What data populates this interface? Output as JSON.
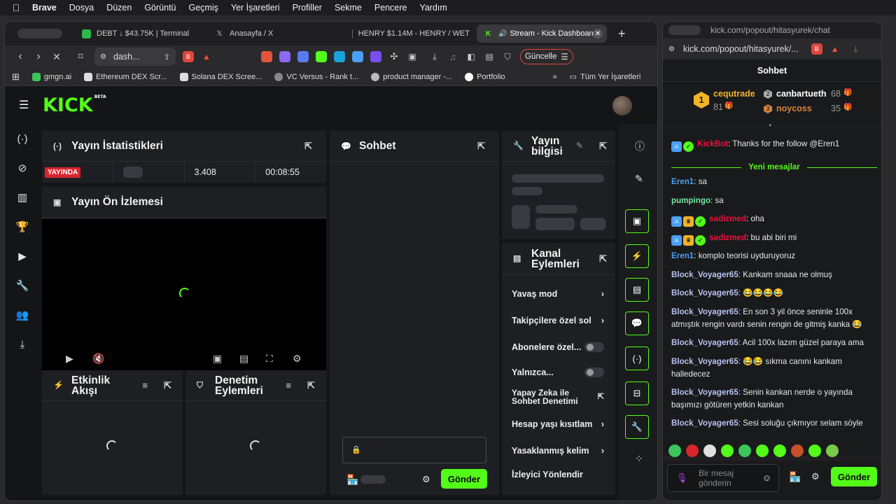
{
  "menubar": {
    "apple": "",
    "items": [
      "Brave",
      "Dosya",
      "Düzen",
      "Görüntü",
      "Geçmiş",
      "Yer İşaretleri",
      "Profiller",
      "Sekme",
      "Pencere",
      "Yardım"
    ]
  },
  "tabs": [
    {
      "title": "DEBT ↓ $43.75K | Terminal",
      "color": "#2fb84a"
    },
    {
      "title": "Anasayfa / X",
      "color": "#000000"
    },
    {
      "title": "HENRY $1.14M - HENRY / WET",
      "color": "#777777"
    },
    {
      "title": "Stream - Kick Dashboard",
      "color": "#53fc18"
    }
  ],
  "newtab": "+",
  "address": {
    "url": "dash...",
    "update_label": "Güncelle"
  },
  "bookmarks": [
    {
      "label": "gmgn.ai",
      "color": "#3cc55b"
    },
    {
      "label": "Ethereum DEX Scr...",
      "color": "#dddddd"
    },
    {
      "label": "Solana DEX Scree...",
      "color": "#dddddd"
    },
    {
      "label": "VC Versus - Rank t...",
      "color": "#aaaaaa"
    },
    {
      "label": "product manager -...",
      "color": "#cccccc"
    },
    {
      "label": "Portfolio",
      "color": "#ffffff"
    }
  ],
  "bookmarks_more": "»",
  "bookmarks_all": "Tüm Yer İşaretleri",
  "kick": {
    "logo": "KICK",
    "logo_beta": "BETA",
    "stats": {
      "title": "Yayın İstatistikleri",
      "live": "YAYINDA",
      "viewers": "3.408",
      "duration": "00:08:55"
    },
    "preview": {
      "title": "Yayın Ön İzlemesi"
    },
    "chat": {
      "title": "Sohbet",
      "send": "Gönder"
    },
    "stream_info": {
      "title_line1": "Yayın",
      "title_line2": "bilgisi"
    },
    "channel_actions": {
      "title_line1": "Kanal",
      "title_line2": "Eylemleri",
      "items": [
        {
          "label": "Yavaş mod",
          "kind": "chevron"
        },
        {
          "label": "Takipçilere özel sol",
          "kind": "chevron"
        },
        {
          "label": "Abonelere özel...",
          "kind": "toggle"
        },
        {
          "label": "Yalnızca...",
          "kind": "toggle"
        },
        {
          "label": "Yapay Zeka ile Sohbet Denetimi",
          "kind": "external"
        },
        {
          "label": "Hesap yaşı kısıtlam",
          "kind": "chevron"
        },
        {
          "label": "Yasaklanmış kelim",
          "kind": "chevron"
        },
        {
          "label": "İzleyici Yönlendir",
          "kind": "none"
        }
      ]
    },
    "activity": {
      "title_line1": "Etkinlik",
      "title_line2": "Akışı"
    },
    "moderation": {
      "title_line1": "Denetim",
      "title_line2": "Eylemleri"
    }
  },
  "popout": {
    "title_url": "kick.com/popout/hitasyurek/chat",
    "url": "kick.com/popout/hitasyurek/...",
    "header": "Sohbet",
    "leaders": {
      "first": {
        "rank": "1",
        "name": "cequtrade",
        "count": "81"
      },
      "second": {
        "rank": "2",
        "name": "canbartueth",
        "count": "68"
      },
      "third": {
        "rank": "3",
        "name": "noycoss",
        "count": "35"
      }
    },
    "new_messages": "Yeni mesajlar",
    "messages": [
      {
        "user": "KickBot",
        "text": "Thanks for the follow @Eren1",
        "color": "#e9113c",
        "badges": 2
      },
      {
        "user": "Eren1",
        "text": "sa",
        "color": "#4a9ff5",
        "badges": 0
      },
      {
        "user": "pumpingo",
        "text": "sa",
        "color": "#72e9a0",
        "badges": 0
      },
      {
        "user": "sadizmed",
        "text": "oha",
        "color": "#e9113c",
        "badges": 3
      },
      {
        "user": "sadizmed",
        "text": "bu abi biri mi",
        "color": "#e9113c",
        "badges": 3
      },
      {
        "user": "Eren1",
        "text": "komplo teorisi uyduruyoruz",
        "color": "#4a9ff5",
        "badges": 0
      },
      {
        "user": "Block_Voyager65",
        "text": "Kankam snaaa ne olmuş",
        "color": "#b9c2f0",
        "badges": 0
      },
      {
        "user": "Block_Voyager65",
        "text": "😂😂😂😂",
        "color": "#b9c2f0",
        "badges": 0
      },
      {
        "user": "Block_Voyager65",
        "text": "En son 3 yil önce seninle 100x atmıştık rengin vardı senin rengin de gitmiş kanka 😂",
        "color": "#b9c2f0",
        "badges": 0
      },
      {
        "user": "Block_Voyager65",
        "text": "Acil 100x lazım güzel paraya ama",
        "color": "#b9c2f0",
        "badges": 0
      },
      {
        "user": "Block_Voyager65",
        "text": "😂😂 sıkma canını kankam halledecez",
        "color": "#b9c2f0",
        "badges": 0
      },
      {
        "user": "Block_Voyager65",
        "text": "Senin kankan nerde o yayında başımızı götüren yetkin kankan",
        "color": "#b9c2f0",
        "badges": 0
      },
      {
        "user": "Block_Voyager65",
        "text": "Sesi soluğu çıkmıyor selam söyle",
        "color": "#b9c2f0",
        "badges": 0
      }
    ],
    "input_placeholder": "Bir mesaj gönderin",
    "send": "Gönder"
  },
  "colors": {
    "accent": "#53fc18",
    "live": "#d9262c"
  }
}
